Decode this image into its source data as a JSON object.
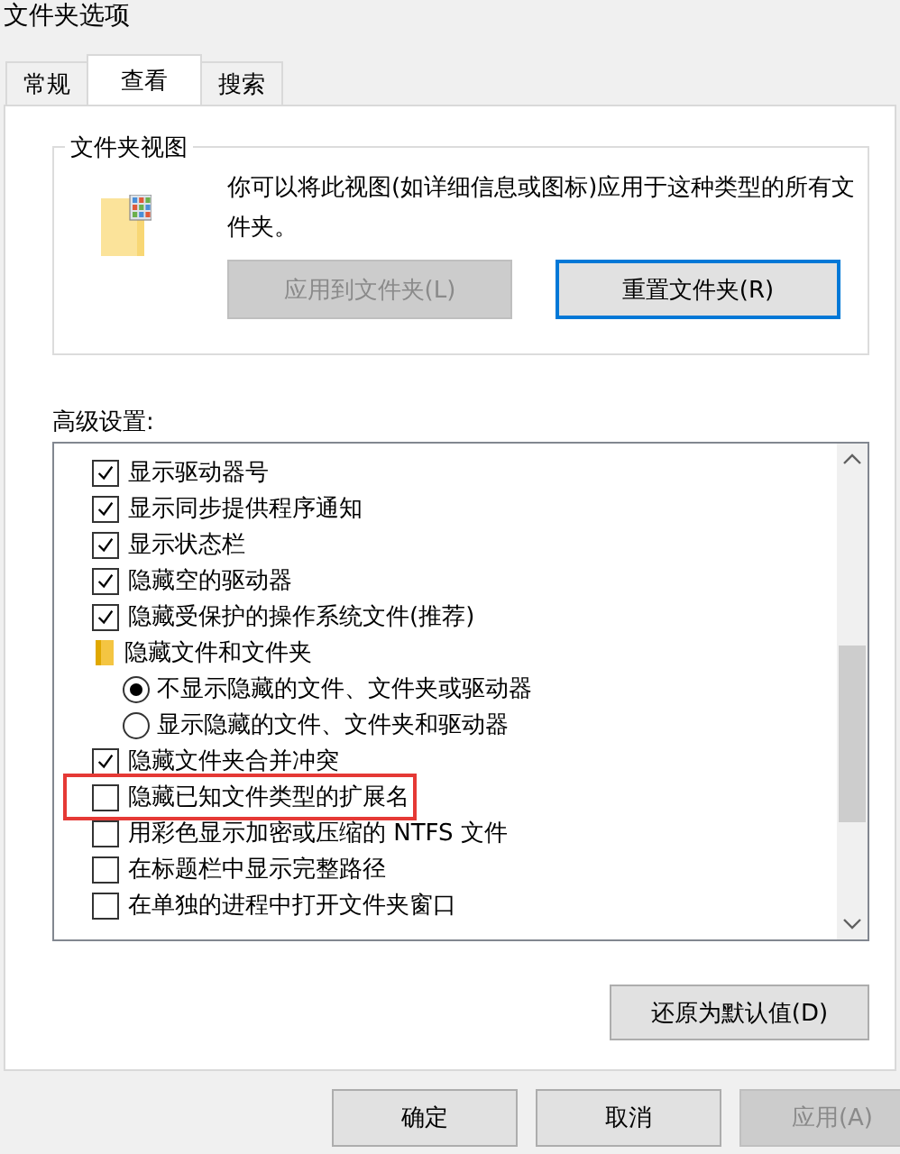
{
  "window": {
    "title": "文件夹选项"
  },
  "tabs": [
    {
      "label": "常规",
      "selected": false
    },
    {
      "label": "查看",
      "selected": true
    },
    {
      "label": "搜索",
      "selected": false
    }
  ],
  "folder_views": {
    "title": "文件夹视图",
    "description": "你可以将此视图(如详细信息或图标)应用于这种类型的所有文件夹。",
    "buttons": [
      {
        "label": "应用到文件夹(L)",
        "disabled": true,
        "focused": false
      },
      {
        "label": "重置文件夹(R)",
        "disabled": false,
        "focused": true
      }
    ]
  },
  "advanced": {
    "title": "高级设置:",
    "items": [
      {
        "kind": "checkbox",
        "label": "显示驱动器号",
        "checked": true,
        "highlighted": false
      },
      {
        "kind": "checkbox",
        "label": "显示同步提供程序通知",
        "checked": true,
        "highlighted": false
      },
      {
        "kind": "checkbox",
        "label": "显示状态栏",
        "checked": true,
        "highlighted": false
      },
      {
        "kind": "checkbox",
        "label": "隐藏空的驱动器",
        "checked": true,
        "highlighted": false
      },
      {
        "kind": "checkbox",
        "label": "隐藏受保护的操作系统文件(推荐)",
        "checked": true,
        "highlighted": false
      },
      {
        "kind": "folder",
        "label": "隐藏文件和文件夹",
        "children": [
          {
            "kind": "radio",
            "label": "不显示隐藏的文件、文件夹或驱动器",
            "selected": true
          },
          {
            "kind": "radio",
            "label": "显示隐藏的文件、文件夹和驱动器",
            "selected": false
          }
        ]
      },
      {
        "kind": "checkbox",
        "label": "隐藏文件夹合并冲突",
        "checked": true,
        "highlighted": false
      },
      {
        "kind": "checkbox",
        "label": "隐藏已知文件类型的扩展名",
        "checked": false,
        "highlighted": true
      },
      {
        "kind": "checkbox",
        "label": "用彩色显示加密或压缩的 NTFS 文件",
        "checked": false,
        "highlighted": false
      },
      {
        "kind": "checkbox",
        "label": "在标题栏中显示完整路径",
        "checked": false,
        "highlighted": false
      },
      {
        "kind": "checkbox",
        "label": "在单独的进程中打开文件夹窗口",
        "checked": false,
        "highlighted": false
      }
    ],
    "restore_button": "还原为默认值(D)"
  },
  "buttons": [
    {
      "label": "确定",
      "disabled": false
    },
    {
      "label": "取消",
      "disabled": false
    },
    {
      "label": "应用(A)",
      "disabled": true
    }
  ]
}
